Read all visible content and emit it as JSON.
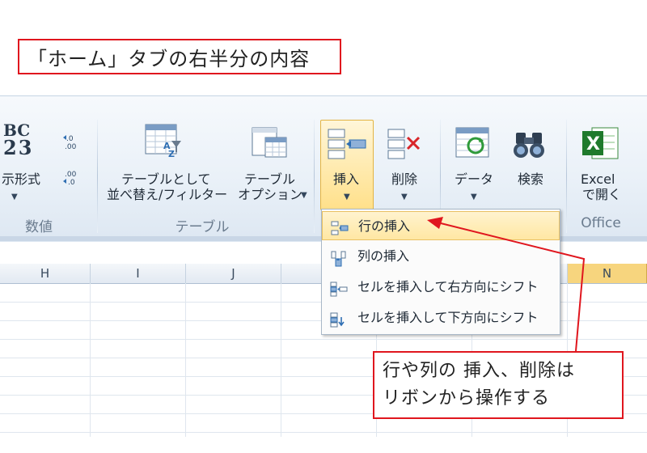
{
  "caption": "「ホーム」タブの右半分の内容",
  "callout_lines": [
    "行や列の 挿入、削除は",
    "リボンから操作する"
  ],
  "ribbon": {
    "number_group": {
      "format_label": "表示形式",
      "format_label_visible": "示形式",
      "group_label": "数値",
      "icon_text_top": "BC",
      "icon_text_bottom": "23"
    },
    "table_group": {
      "sort_filter_line1": "テーブルとして",
      "sort_filter_line2": "並べ替え/フィルター",
      "options_line1": "テーブル",
      "options_line2": "オプション",
      "group_label": "テーブル"
    },
    "cells_group": {
      "insert_label": "挿入",
      "delete_label": "削除"
    },
    "data_group": {
      "data_label": "データ",
      "search_label": "検索"
    },
    "office_group": {
      "excel_line1": "Excel",
      "excel_line2": "で開く",
      "group_label": "Office"
    }
  },
  "dropdown": {
    "items": [
      {
        "label": "行の挿入",
        "icon": "insert-row-icon"
      },
      {
        "label": "列の挿入",
        "icon": "insert-column-icon"
      },
      {
        "label": "セルを挿入して右方向にシフト",
        "icon": "insert-cells-shift-right-icon"
      },
      {
        "label": "セルを挿入して下方向にシフト",
        "icon": "insert-cells-shift-down-icon"
      }
    ]
  },
  "columns": [
    "H",
    "I",
    "J",
    "N"
  ],
  "colors": {
    "accent_red": "#e0161e",
    "ribbon_bg": "#eaf1f8",
    "highlight": "#ffe08a",
    "selected_column": "#f7d57e"
  }
}
